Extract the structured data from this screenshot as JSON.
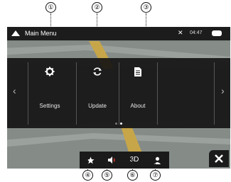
{
  "callouts": {
    "top": [
      "①",
      "②",
      "③"
    ],
    "bottom": [
      "④",
      "⑤",
      "⑥",
      "⑦"
    ]
  },
  "status_bar": {
    "title": "Main Menu",
    "time": "04:47",
    "gps_icon": "gps-off-icon",
    "message_icon": "message-icon"
  },
  "menu": {
    "items": [
      {
        "label": "Settings",
        "icon": "gear-icon"
      },
      {
        "label": "Update",
        "icon": "refresh-icon"
      },
      {
        "label": "About",
        "icon": "document-icon"
      }
    ],
    "left_arrow": "‹",
    "right_arrow": "›"
  },
  "bottom_bar": {
    "favorite_icon": "star-icon",
    "sound_icon": "speaker-icon",
    "view_mode": "3D",
    "profile_icon": "person-icon"
  },
  "close_icon": "close-icon"
}
